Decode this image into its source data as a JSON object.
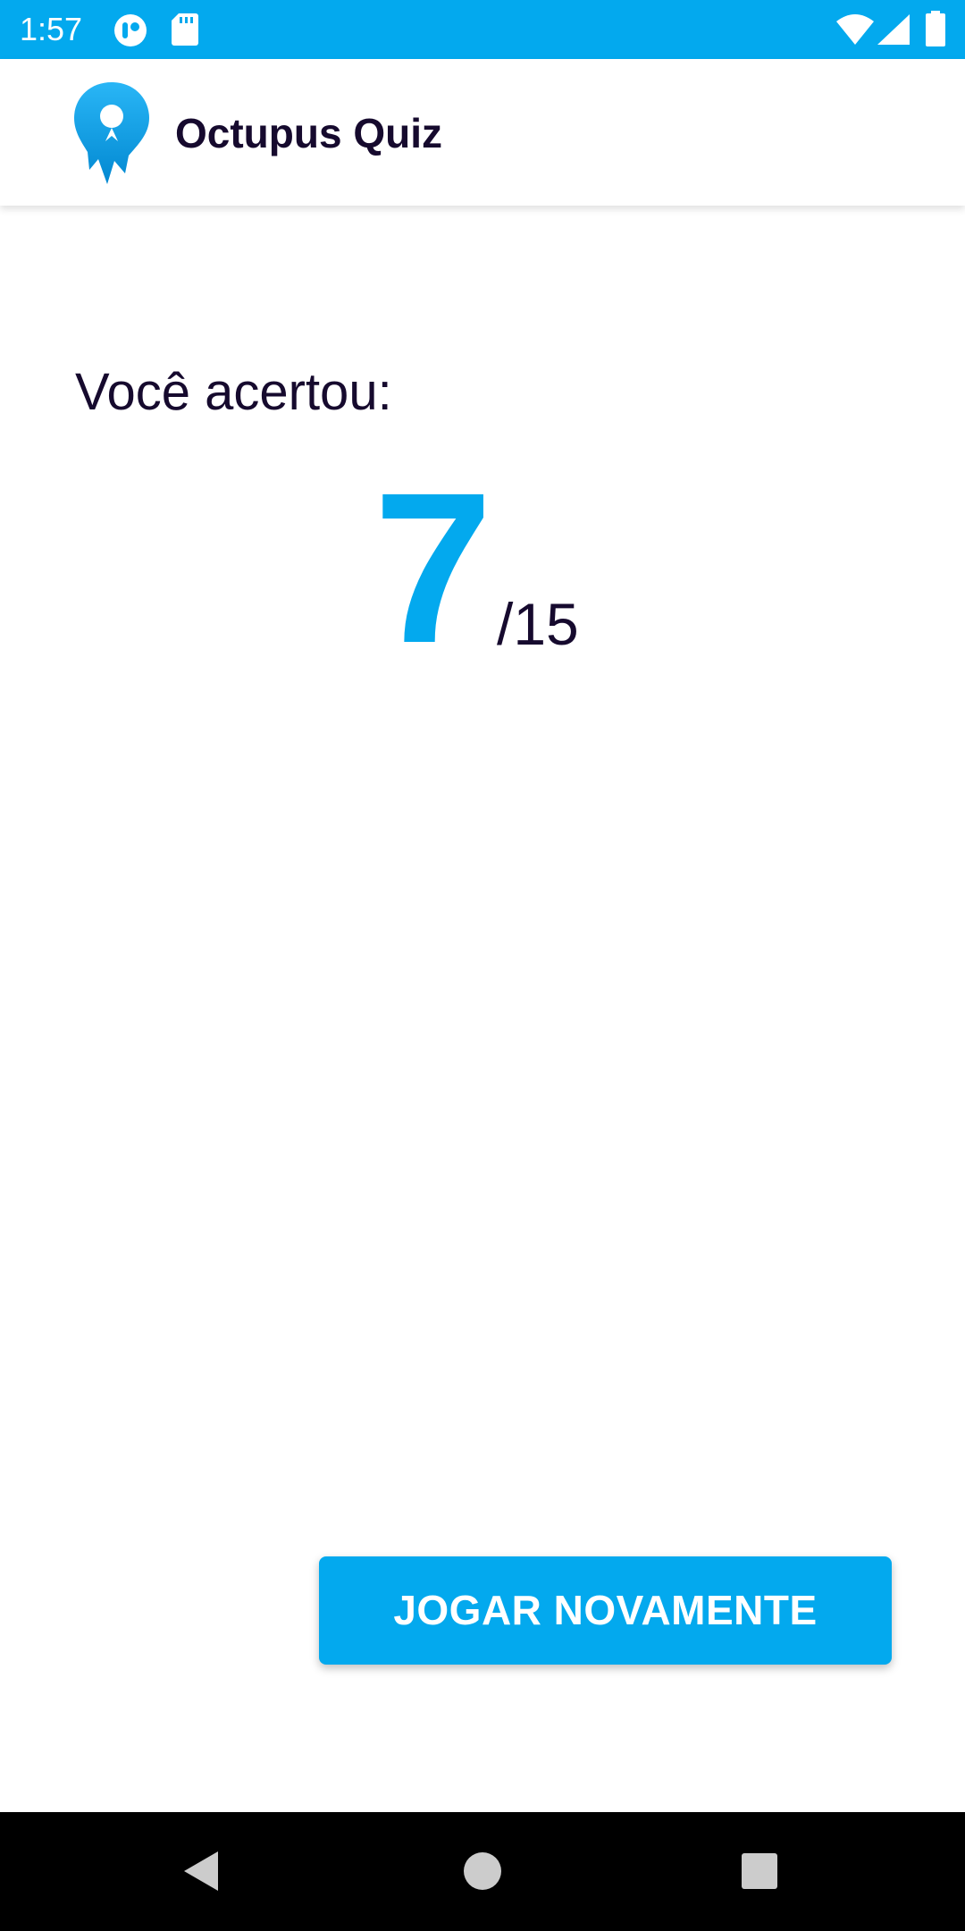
{
  "status_bar": {
    "time": "1:57",
    "background_color": "#03A9EE",
    "left_icons": [
      "notification-app-icon",
      "sd-card-icon"
    ],
    "right_icons": [
      "wifi-icon",
      "signal-icon",
      "battery-icon"
    ]
  },
  "app_bar": {
    "title": "Octupus Quiz",
    "logo": "octopus-pin-logo"
  },
  "result": {
    "label": "Você acertou:",
    "score": "7",
    "total": "/15",
    "score_color": "#03A9EE"
  },
  "actions": {
    "play_again_label": "JOGAR NOVAMENTE",
    "button_color": "#03A9EE"
  },
  "nav_bar": {
    "buttons": [
      "back-icon",
      "home-icon",
      "recents-icon"
    ]
  }
}
